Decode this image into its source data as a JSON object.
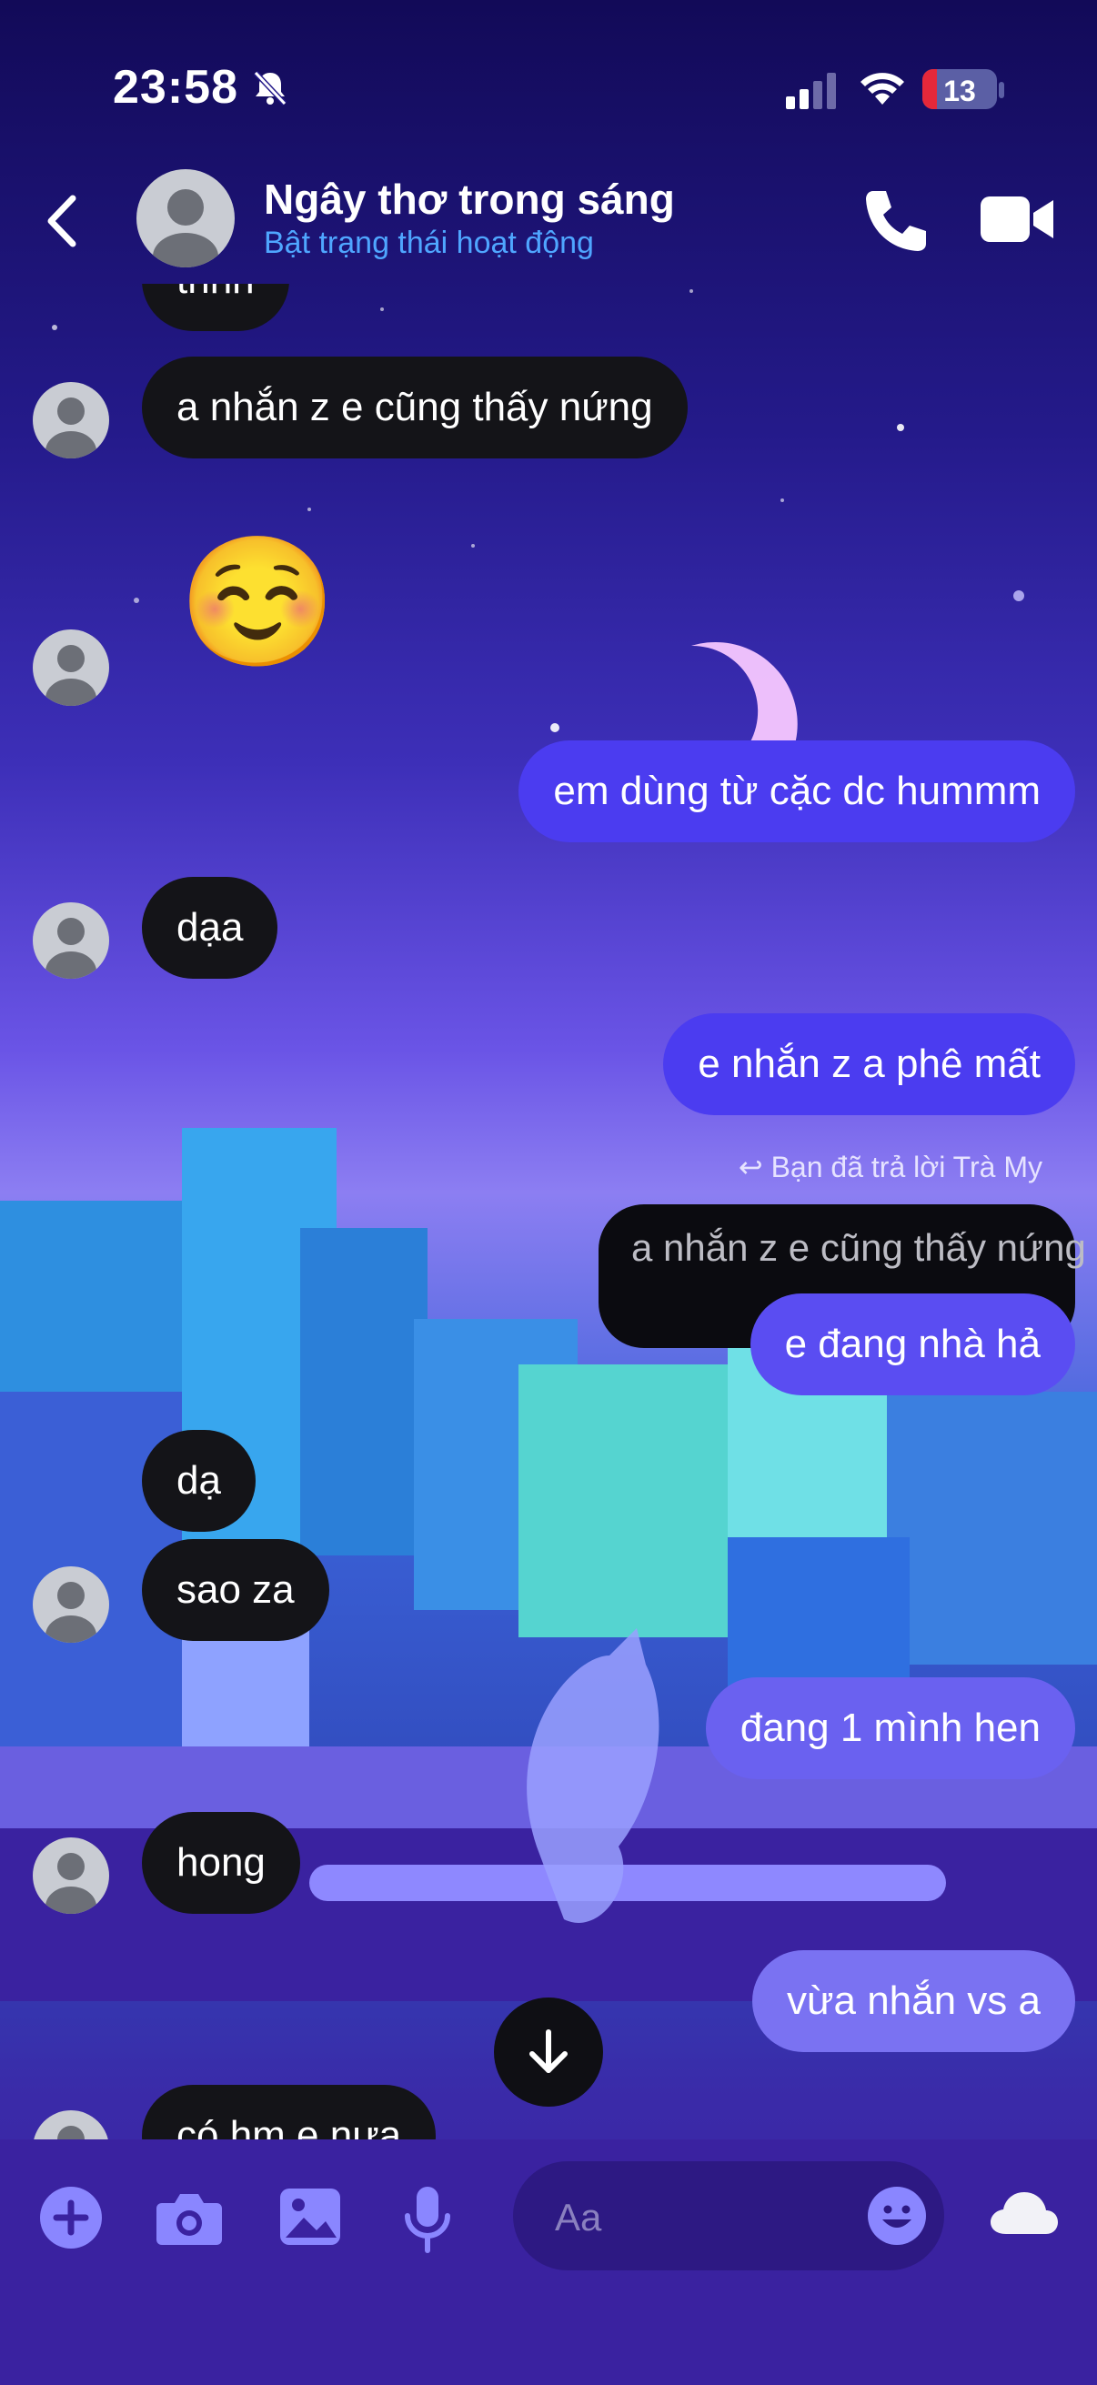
{
  "status_bar": {
    "time": "23:58",
    "battery": "13"
  },
  "header": {
    "contact_name": "Ngây thơ trong sáng",
    "status_text": "Bật trạng thái hoạt động"
  },
  "messages": {
    "m1": "tnhh",
    "m2": "a nhắn z e cũng thấy nứng",
    "m3_emoji": "☺️",
    "m4": "em dùng từ cặc dc hummm",
    "m5": "dạa",
    "m6": "e nhắn z a phê mất",
    "reply_note": "Bạn đã trả lời Trà My",
    "quoted": "a nhắn z e cũng thấy nứng",
    "m7": "e đang nhà hả",
    "m8": "dạ",
    "m9": "sao za",
    "m10": "đang 1 mình hen",
    "m11": "hong",
    "m12": "vừa nhắn vs a",
    "m13": "có hm e nưa"
  },
  "composer": {
    "placeholder": "Aa"
  },
  "colors": {
    "outgoing_bubble": "#4b3cf0",
    "incoming_bubble": "#141418",
    "link_blue": "#4fa6ff",
    "battery_low": "#e5283a"
  },
  "icons": [
    "back-icon",
    "phone-icon",
    "video-icon",
    "plus-icon",
    "camera-icon",
    "image-icon",
    "microphone-icon",
    "emoji-icon",
    "cloud-icon",
    "arrow-down-icon",
    "bell-off-icon",
    "signal-icon",
    "wifi-icon"
  ]
}
